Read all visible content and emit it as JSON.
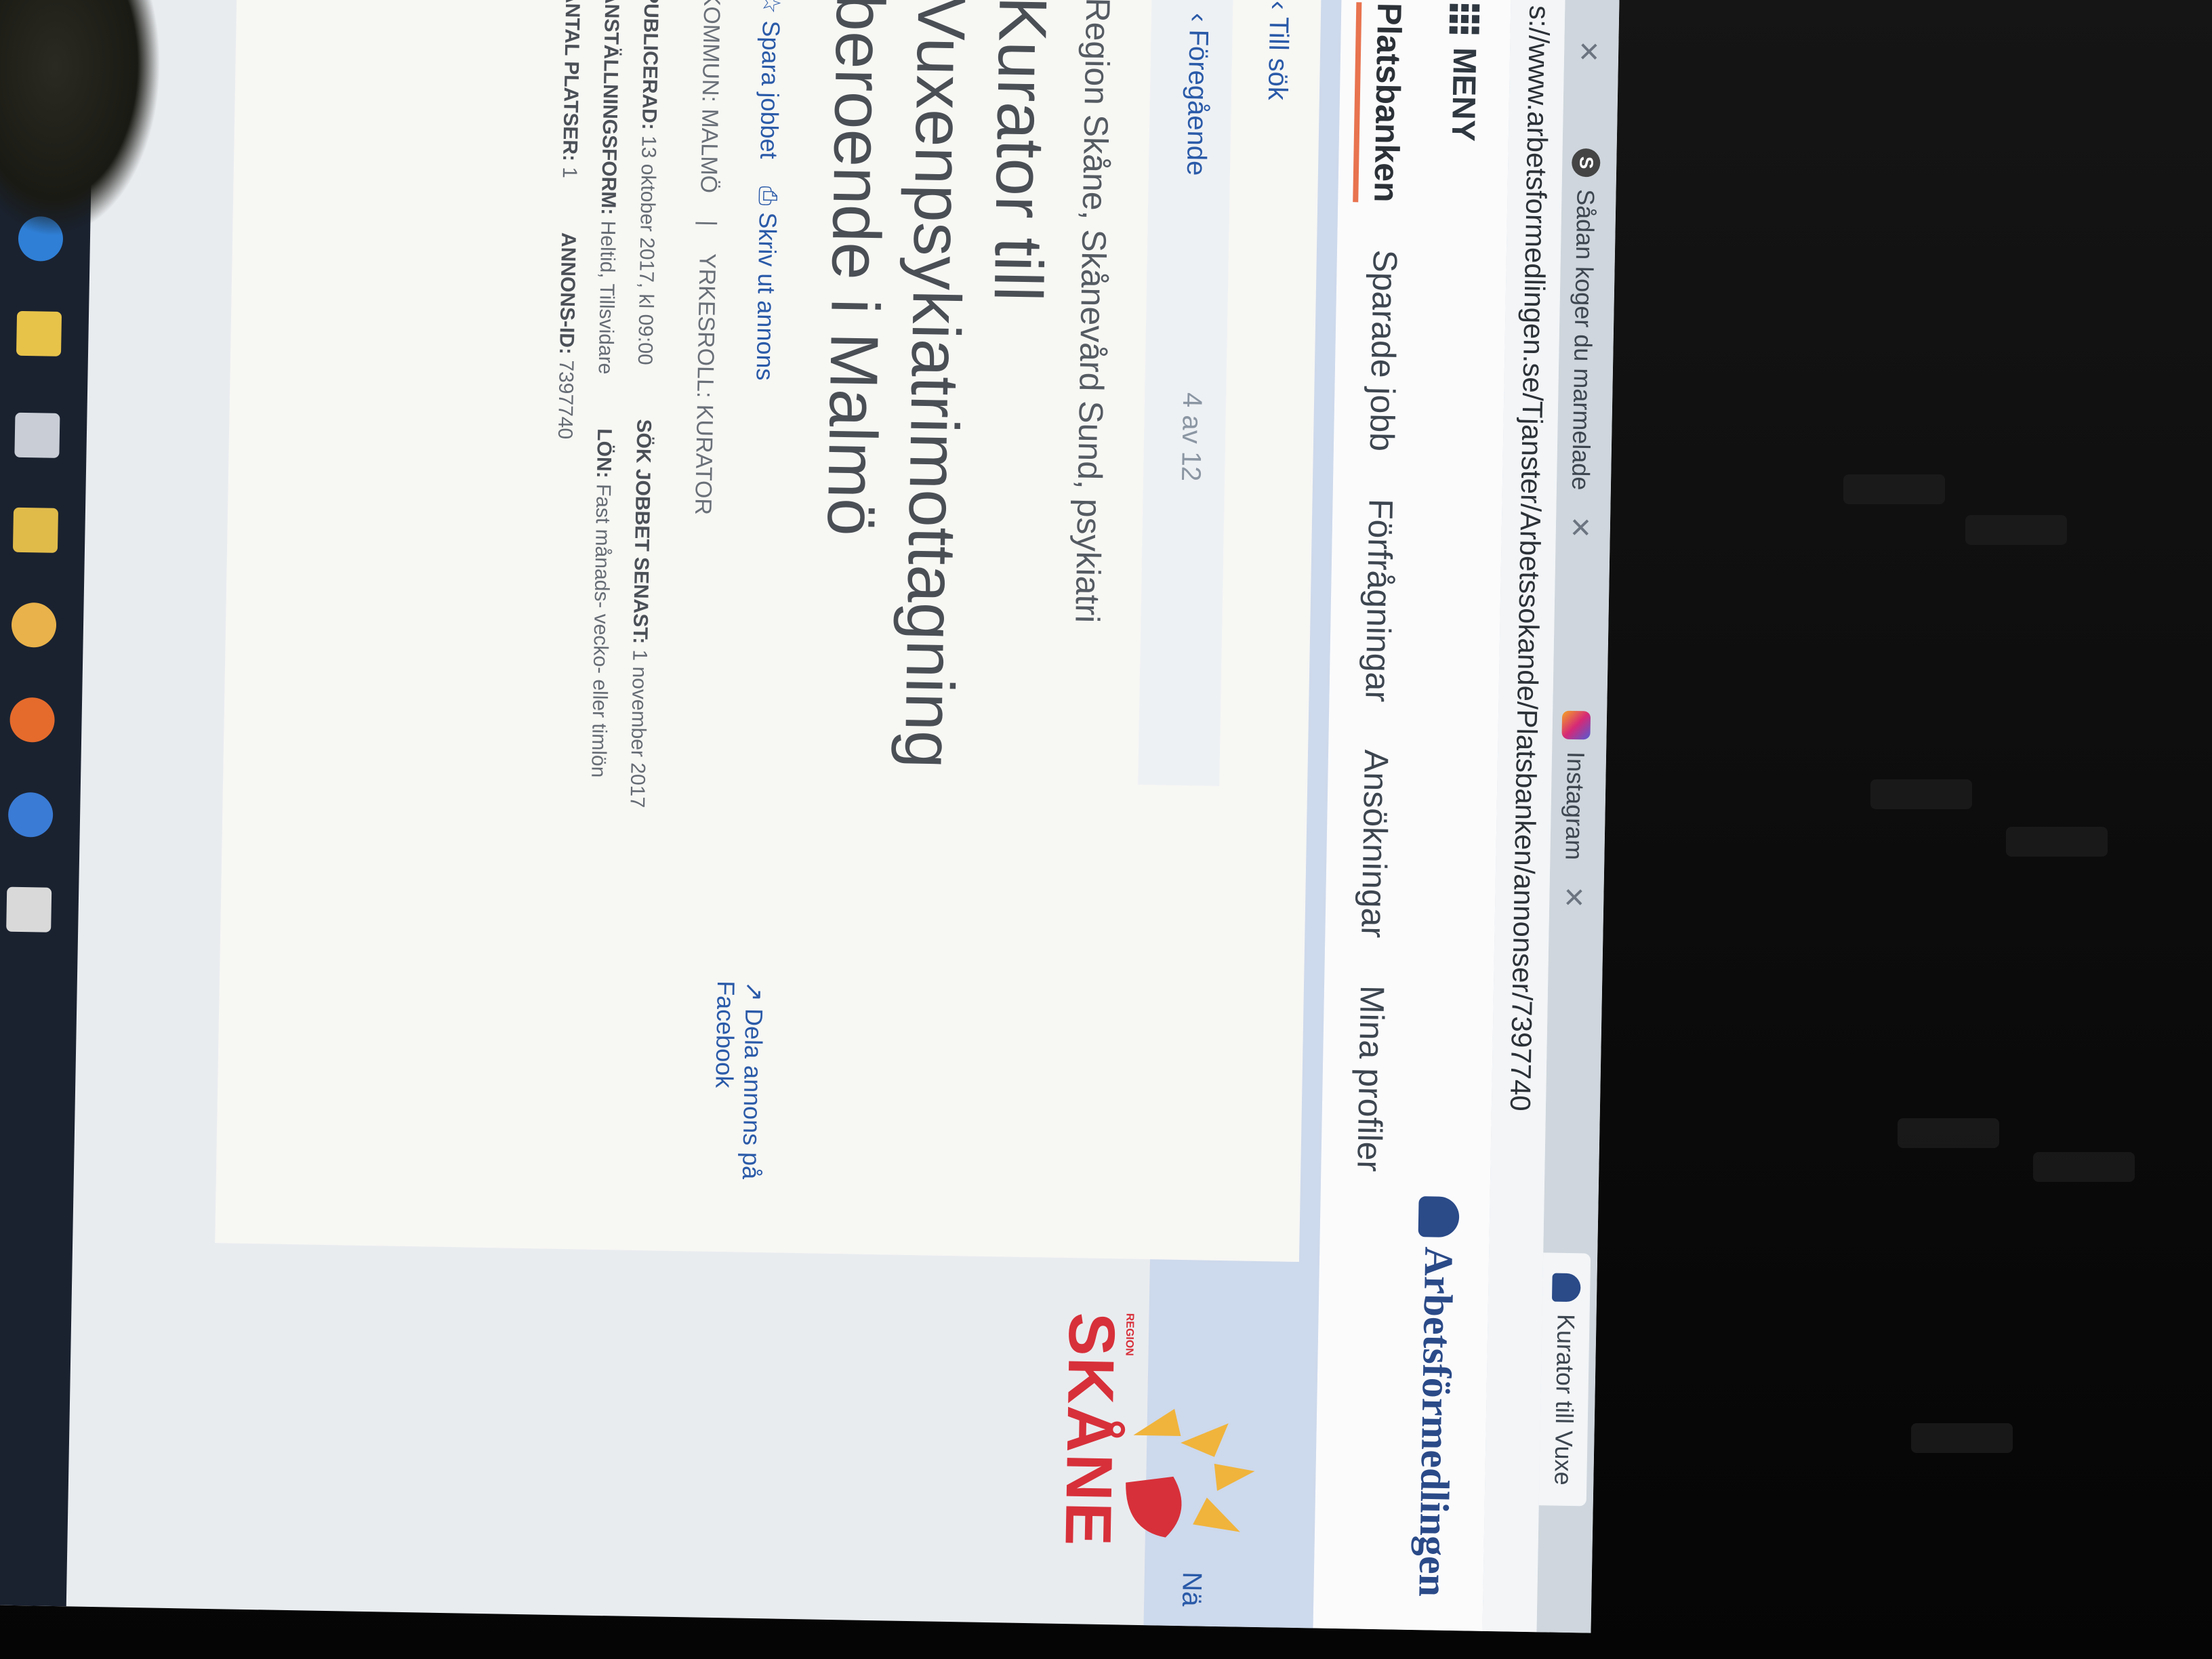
{
  "browser": {
    "tabs": [
      {
        "label": "Sådan koger du marmelade",
        "favicon": "s-icon"
      },
      {
        "label": "Instagram",
        "favicon": "instagram-icon"
      },
      {
        "label": "Kurator till Vuxe",
        "favicon": "arbetsformedlingen-icon"
      }
    ],
    "url": "s://www.arbetsformedlingen.se/Tjanster/Arbetssokande/Platsbanken/annonser/7397740"
  },
  "site": {
    "menu_label": "MENY",
    "logo_text": "Arbetsförmedlingen",
    "nav": [
      "Platsbanken",
      "Sparade jobb",
      "Förfrågningar",
      "Ansökningar",
      "Mina profiler"
    ],
    "active_nav": "Platsbanken"
  },
  "listing_nav": {
    "back": "Till sök",
    "previous": "Föregående",
    "counter": "4 av 12",
    "next": "Nä"
  },
  "ad": {
    "employer": "Region Skåne, Skånevård Sund, psykiatri",
    "title": "Kurator till Vuxenpsykiatrimottagning beroende i Malmö",
    "save_job": "Spara jobbet",
    "print": "Skriv ut annons",
    "share": "Dela annons på Facebook",
    "kommun_label": "KOMMUN:",
    "kommun_value": "MALMÖ",
    "yrkesroll_label": "YRKESROLL:",
    "yrkesroll_value": "KURATOR",
    "publicerad_label": "PUBLICERAD:",
    "publicerad_value": "13 oktober 2017, kl 09:00",
    "sok_senast_label": "SÖK JOBBET SENAST:",
    "sok_senast_value": "1 november 2017",
    "anstallning_label": "ANSTÄLLNINGSFORM:",
    "anstallning_value": "Heltid, Tillsvidare",
    "lon_label": "LÖN:",
    "lon_value": "Fast månads- vecko- eller timlön",
    "platser_label": "ANTAL PLATSER:",
    "platser_value": "1",
    "annons_id_label": "ANNONS-ID:",
    "annons_id_value": "7397740"
  },
  "employer_logo": {
    "small": "REGION",
    "word": "SKÅNE"
  },
  "colors": {
    "accent": "#e8734f",
    "link": "#2a5aa8",
    "brand_blue": "#2a4a88",
    "skane_red": "#d7303a",
    "skane_yellow": "#f0b43c"
  }
}
